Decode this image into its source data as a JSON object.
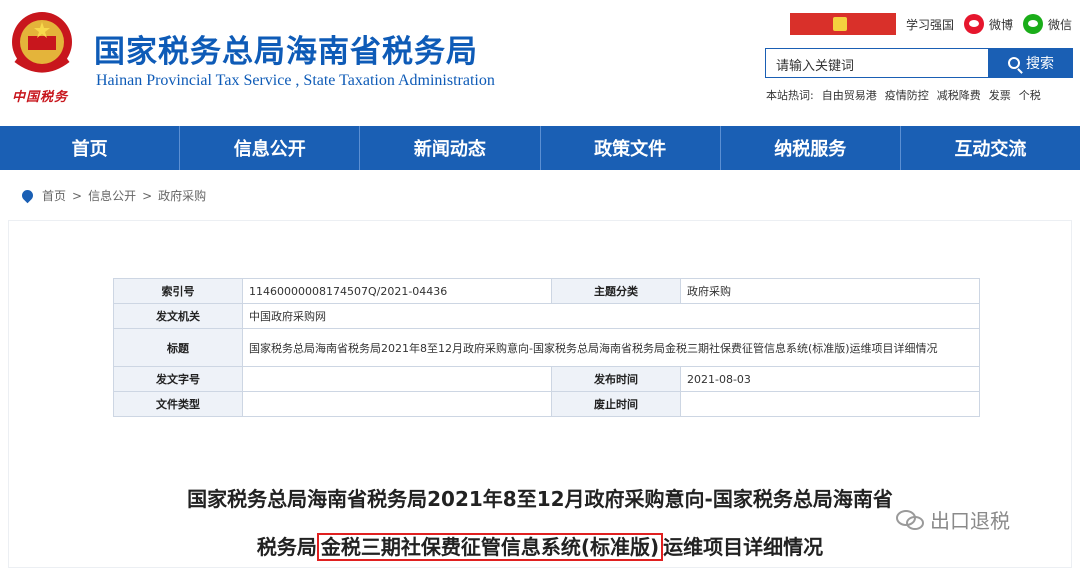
{
  "header": {
    "title": "国家税务总局海南省税务局",
    "subtitle": "Hainan Provincial Tax Service , State Taxation Administration",
    "emblem_text": "中国税务"
  },
  "topbar": {
    "xuexi": "学习强国",
    "weibo": "微博",
    "wechat": "微信"
  },
  "search": {
    "placeholder": "请输入关键词",
    "button": "搜索",
    "hot_label": "本站热词:",
    "hot_words": [
      "自由贸易港",
      "疫情防控",
      "减税降费",
      "发票",
      "个税"
    ]
  },
  "nav": [
    "首页",
    "信息公开",
    "新闻动态",
    "政策文件",
    "纳税服务",
    "互动交流"
  ],
  "breadcrumb": [
    "首页",
    "信息公开",
    "政府采购"
  ],
  "meta": {
    "index_label": "索引号",
    "index_value": "11460000008174507Q/2021-04436",
    "topic_label": "主题分类",
    "topic_value": "政府采购",
    "org_label": "发文机关",
    "org_value": "中国政府采购网",
    "title_label": "标题",
    "title_value": "国家税务总局海南省税务局2021年8至12月政府采购意向-国家税务总局海南省税务局金税三期社保费征管信息系统(标准版)运维项目详细情况",
    "docno_label": "发文字号",
    "docno_value": "",
    "date_label": "发布时间",
    "date_value": "2021-08-03",
    "type_label": "文件类型",
    "type_value": "",
    "expire_label": "废止时间",
    "expire_value": ""
  },
  "article": {
    "title_line1": "国家税务总局海南省税务局2021年8至12月政府采购意向-国家税务总局海南省",
    "title_line2_pre": "税务局",
    "title_line2_highlight": "金税三期社保费征管信息系统(标准版)",
    "title_line2_post": "运维项目详细情况"
  },
  "watermark": "出口退税",
  "colors": {
    "brand": "#1a5fb4",
    "title": "#0e5bb7",
    "highlight": "#e02020"
  }
}
